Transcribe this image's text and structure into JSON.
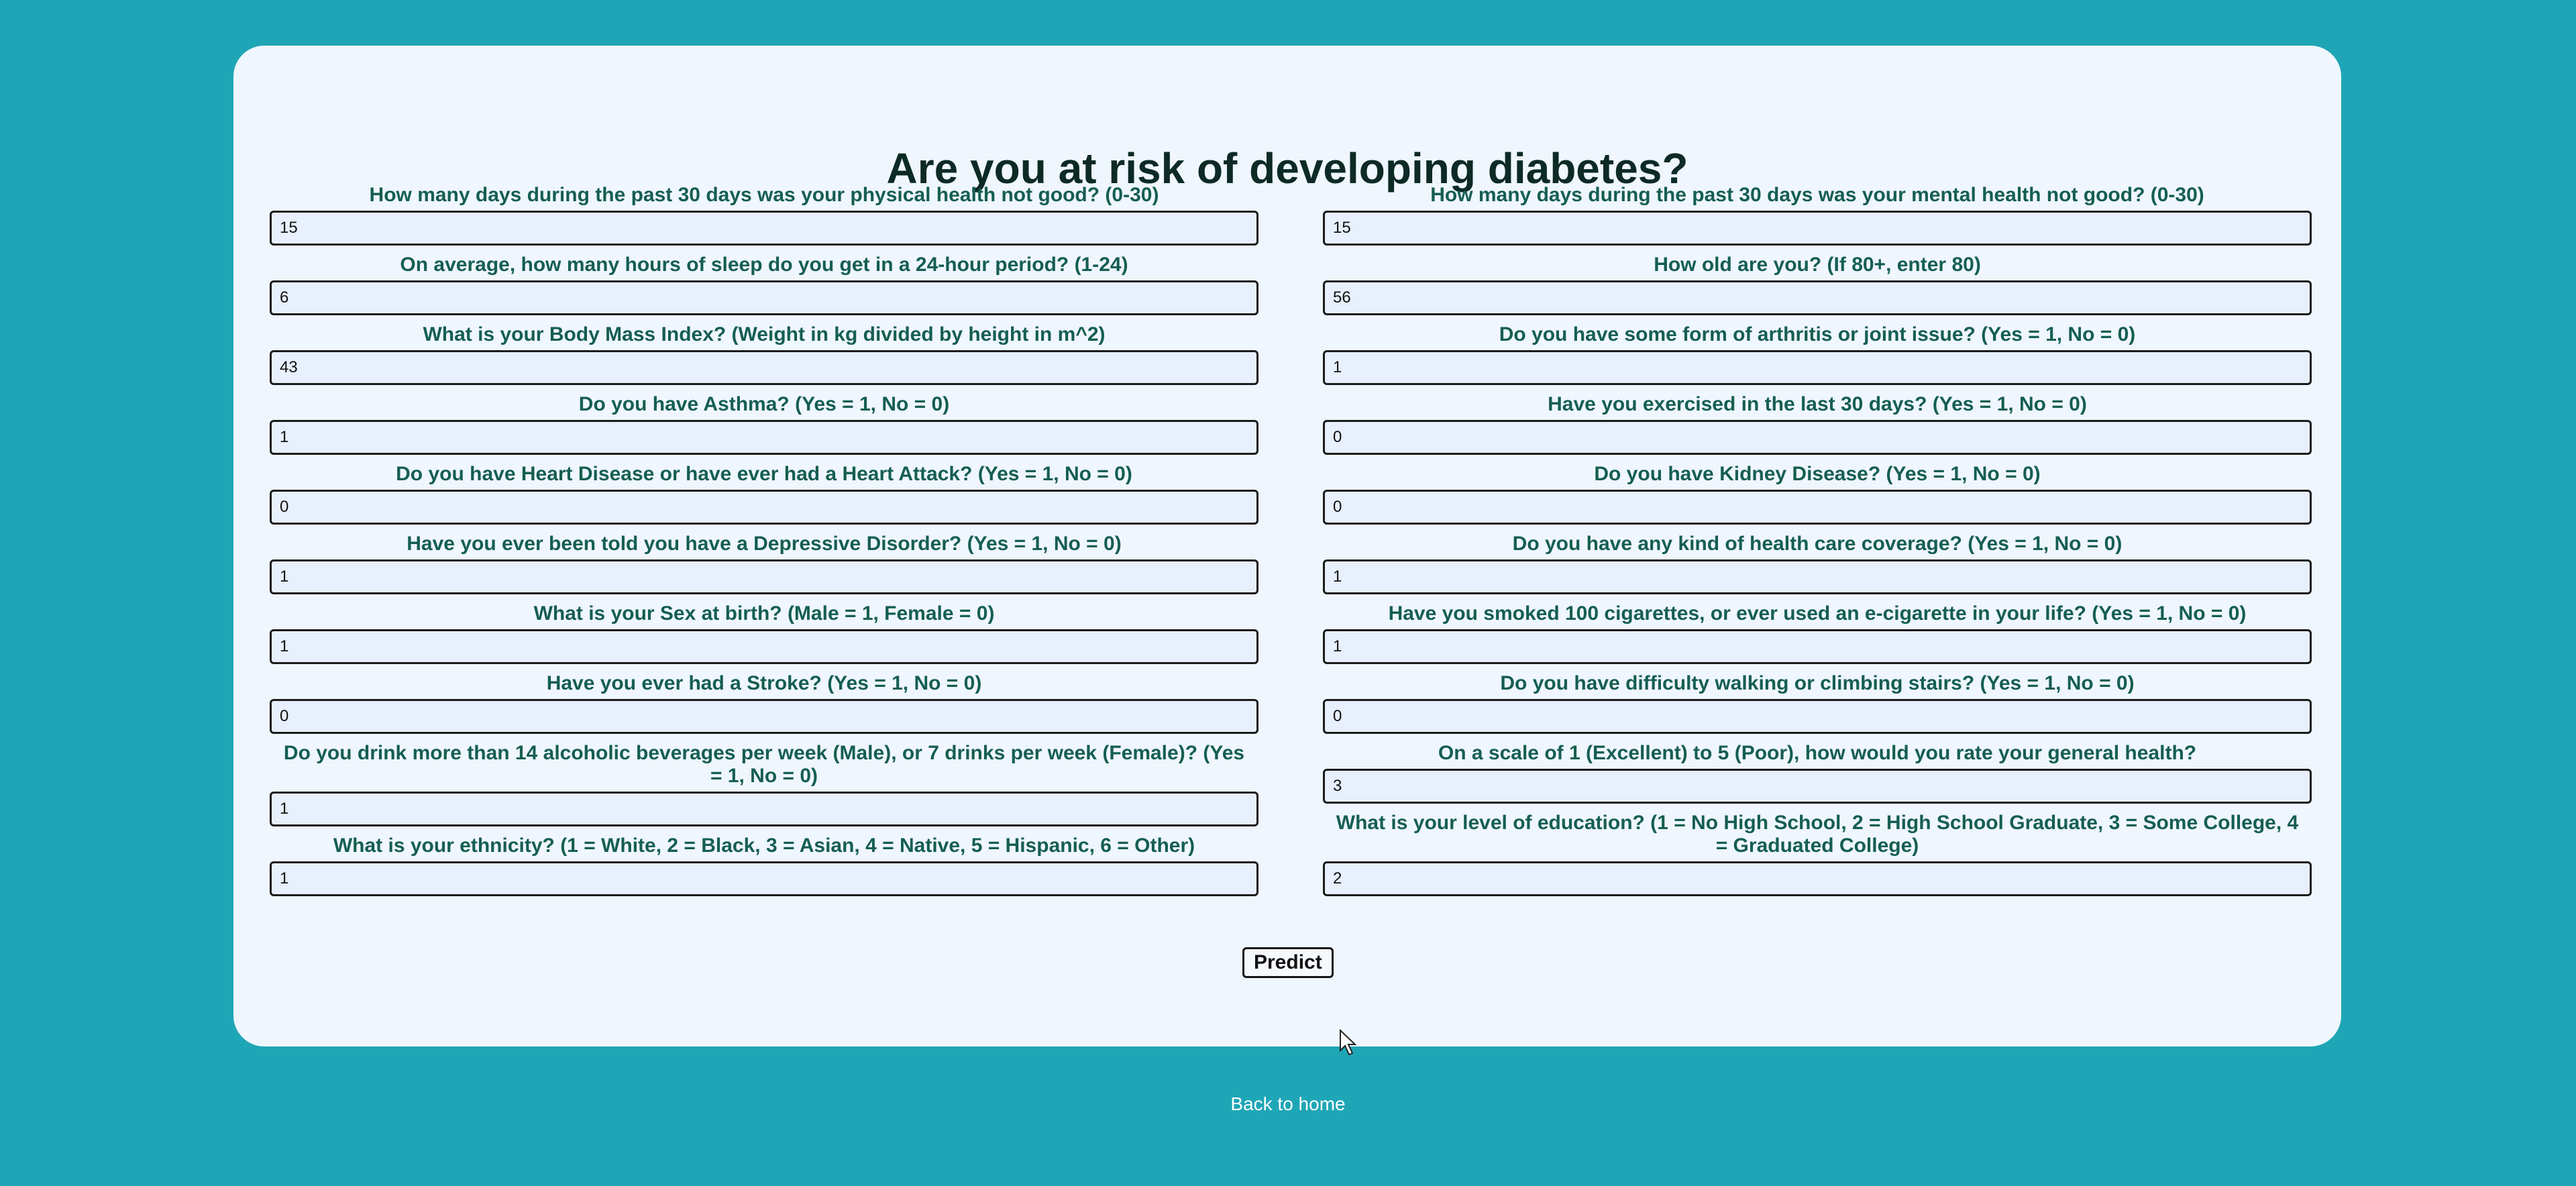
{
  "page": {
    "title": "Are you at risk of developing diabetes?",
    "predict_label": "Predict",
    "back_link": "Back to home"
  },
  "left_questions": [
    {
      "label": "How many days during the past 30 days was your physical health not good? (0-30)",
      "value": "15"
    },
    {
      "label": "On average, how many hours of sleep do you get in a 24-hour period? (1-24)",
      "value": "6"
    },
    {
      "label": "What is your Body Mass Index? (Weight in kg divided by height in m^2)",
      "value": "43"
    },
    {
      "label": "Do you have Asthma? (Yes = 1, No = 0)",
      "value": "1"
    },
    {
      "label": "Do you have Heart Disease or have ever had a Heart Attack? (Yes = 1, No = 0)",
      "value": "0"
    },
    {
      "label": "Have you ever been told you have a Depressive Disorder? (Yes = 1, No = 0)",
      "value": "1"
    },
    {
      "label": "What is your Sex at birth? (Male = 1, Female = 0)",
      "value": "1"
    },
    {
      "label": "Have you ever had a Stroke? (Yes = 1, No = 0)",
      "value": "0"
    },
    {
      "label": "Do you drink more than 14 alcoholic beverages per week (Male), or 7 drinks per week (Female)? (Yes = 1, No = 0)",
      "value": "1"
    },
    {
      "label": "What is your ethnicity? (1 = White, 2 = Black, 3 = Asian, 4 = Native, 5 = Hispanic, 6 = Other)",
      "value": "1"
    }
  ],
  "right_questions": [
    {
      "label": "How many days during the past 30 days was your mental health not good? (0-30)",
      "value": "15"
    },
    {
      "label": "How old are you? (If 80+, enter 80)",
      "value": "56"
    },
    {
      "label": "Do you have some form of arthritis or joint issue? (Yes = 1, No = 0)",
      "value": "1"
    },
    {
      "label": "Have you exercised in the last 30 days? (Yes = 1, No = 0)",
      "value": "0"
    },
    {
      "label": "Do you have Kidney Disease? (Yes = 1, No = 0)",
      "value": "0"
    },
    {
      "label": "Do you have any kind of health care coverage? (Yes = 1, No = 0)",
      "value": "1"
    },
    {
      "label": "Have you smoked 100 cigarettes, or ever used an e-cigarette in your life? (Yes = 1, No = 0)",
      "value": "1"
    },
    {
      "label": "Do you have difficulty walking or climbing stairs? (Yes = 1, No = 0)",
      "value": "0"
    },
    {
      "label": "On a scale of 1 (Excellent) to 5 (Poor), how would you rate your general health?",
      "value": "3"
    },
    {
      "label": "What is your level of education? (1 = No High School, 2 = High School Graduate, 3 = Some College, 4 = Graduated College)",
      "value": "2"
    }
  ],
  "colors": {
    "page_background": "#1fa6b6",
    "card_background": "#eff6fd",
    "label_text": "#155e52",
    "input_background": "#e8effd"
  },
  "icons": {
    "cursor": "mouse-pointer-icon"
  }
}
